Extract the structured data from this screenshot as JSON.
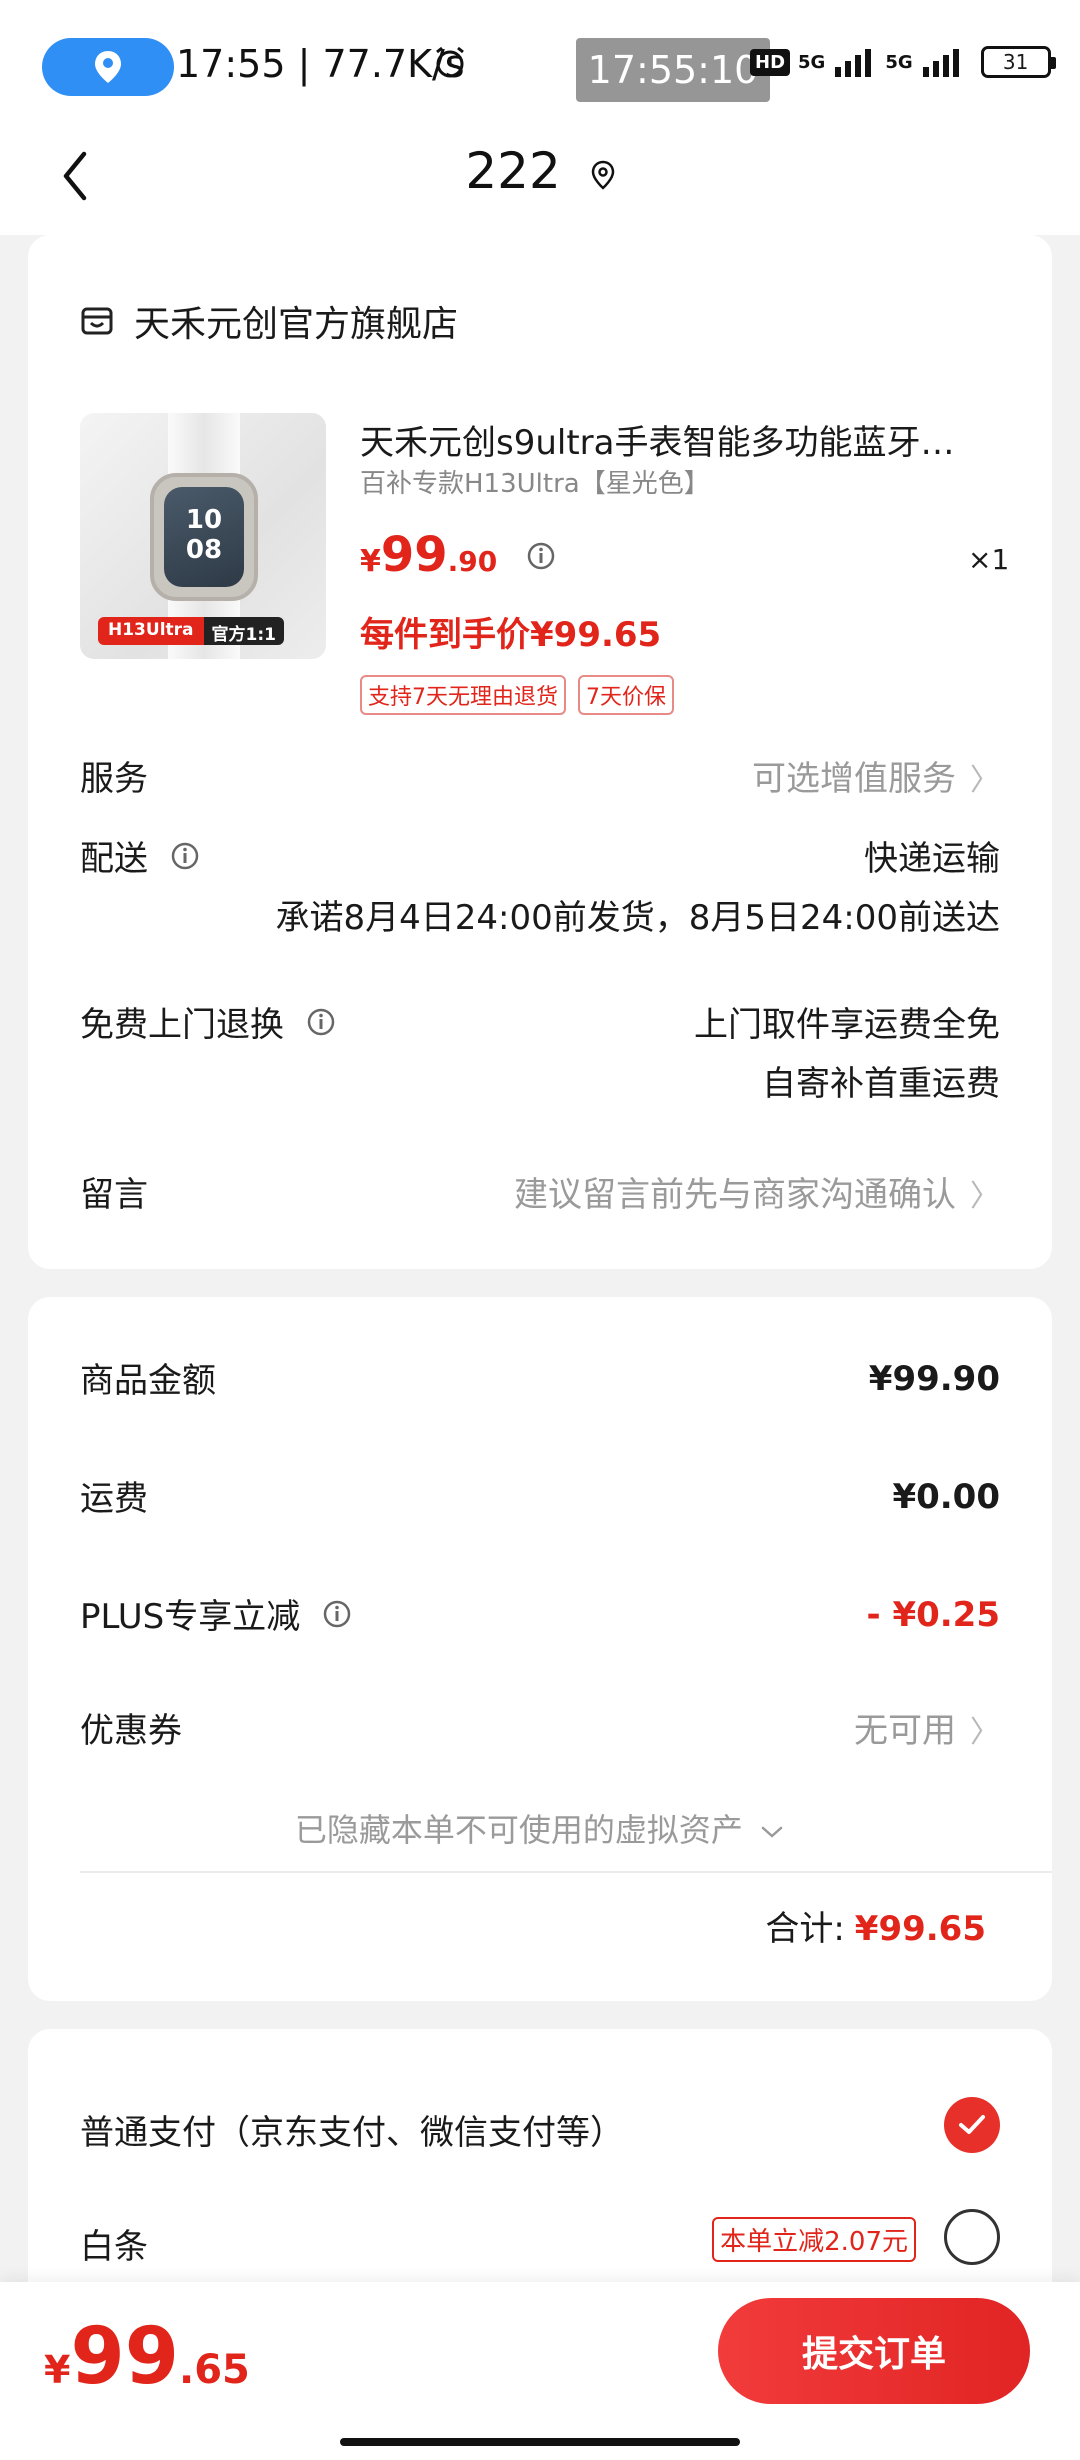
{
  "status_bar": {
    "time_net": "17:55 | 77.7K/s",
    "overlay_time": "17:55:10",
    "hd_label": "HD",
    "net_label_1": "5G",
    "net_label_2": "5G",
    "battery": "31"
  },
  "nav": {
    "title": "222"
  },
  "store": {
    "name": "天禾元创官方旗舰店"
  },
  "product": {
    "image_tag_1": "H13Ultra",
    "image_tag_2": "官方1:1",
    "watch_face_time": "10\n08",
    "title": "天禾元创s9ultra手表智能多功能蓝牙…",
    "variant": "百补专款H13Ultra【星光色】",
    "price_yen": "¥",
    "price_int": "99",
    "price_dec": ".90",
    "qty": "×1",
    "final_price": "每件到手价¥99.65",
    "badges": [
      "支持7天无理由退货",
      "7天价保"
    ]
  },
  "rows": {
    "service_label": "服务",
    "service_value": "可选增值服务",
    "delivery_label": "配送",
    "delivery_value_1": "快递运输",
    "delivery_value_2": "承诺8月4日24:00前发货，8月5日24:00前送达",
    "return_label": "免费上门退换",
    "return_value_1": "上门取件享运费全免",
    "return_value_2": "自寄补首重运费",
    "message_label": "留言",
    "message_value": "建议留言前先与商家沟通确认"
  },
  "summary": {
    "goods_label": "商品金额",
    "goods_value": "¥99.90",
    "shipping_label": "运费",
    "shipping_value": "¥0.00",
    "plus_label": "PLUS专享立减",
    "plus_value": "- ¥0.25",
    "coupon_label": "优惠券",
    "coupon_value": "无可用",
    "hidden_assets": "已隐藏本单不可使用的虚拟资产",
    "total_label": "合计:",
    "total_value": "¥99.65"
  },
  "payment": {
    "normal_label": "普通支付（京东支付、微信支付等）",
    "baitiao_label": "白条",
    "baitiao_tag": "本单立减2.07元"
  },
  "bottom": {
    "price_yen": "¥",
    "price_int": "99",
    "price_dec": ".65",
    "submit_label": "提交订单"
  },
  "colors": {
    "accent": "#e1251b",
    "page_bg": "#f2f2f2",
    "location_pill": "#2f8ff5"
  }
}
